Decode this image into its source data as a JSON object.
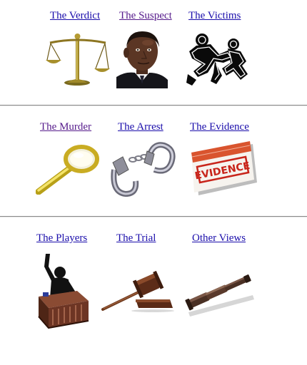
{
  "sections": [
    {
      "items": [
        {
          "label": "The Verdict",
          "icon": "scales-of-justice-icon",
          "visited": false
        },
        {
          "label": "The Suspect",
          "icon": "suspect-portrait",
          "visited": true
        },
        {
          "label": "The Victims",
          "icon": "body-outline-icon",
          "visited": false
        }
      ]
    },
    {
      "items": [
        {
          "label": "The Murder",
          "icon": "magnifying-glass-icon",
          "visited": true
        },
        {
          "label": "The Arrest",
          "icon": "handcuffs-icon",
          "visited": false
        },
        {
          "label": "The Evidence",
          "icon": "evidence-tag-icon",
          "visited": false,
          "stamp_text": "EVIDENCE"
        }
      ]
    },
    {
      "items": [
        {
          "label": "The Players",
          "icon": "witness-stand-icon",
          "visited": false
        },
        {
          "label": "The Trial",
          "icon": "gavel-icon",
          "visited": false
        },
        {
          "label": "Other Views",
          "icon": "telescope-icon",
          "visited": false
        }
      ]
    }
  ],
  "colors": {
    "link_unvisited": "#1a0dab",
    "link_visited": "#551a8b",
    "divider": "#8a8a8a"
  }
}
